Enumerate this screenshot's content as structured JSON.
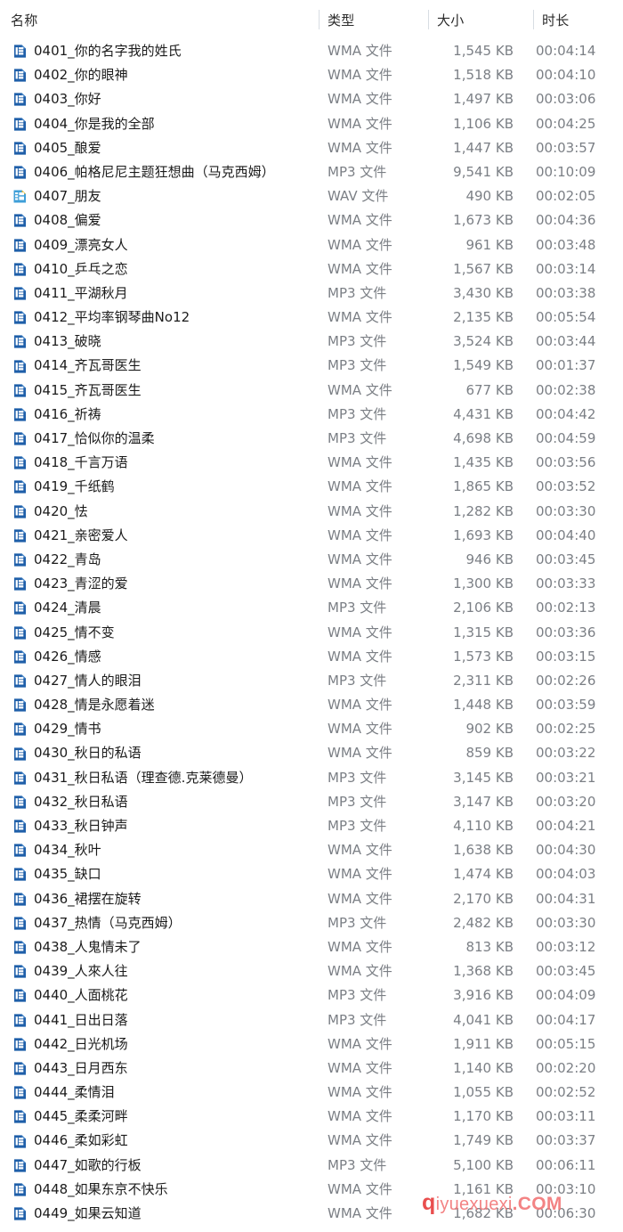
{
  "window": {
    "view": "details",
    "title": "名称"
  },
  "columns": {
    "name": "名称",
    "type": "类型",
    "size": "大小",
    "length": "时长"
  },
  "colors": {
    "header_text": "#2b2b2b",
    "row_text": "#1b1b1b",
    "meta_text": "#7b7f85",
    "separator": "#d8dde3",
    "wma_icon": "#1f5fa9",
    "wav_icon": "#3f9fd8",
    "wav_icon_accent": "#f2c233",
    "watermark": "#f2797a",
    "background": "#ffffff"
  },
  "watermark": {
    "lead": "q",
    "mid": "iyuexuexi",
    "tail": ".COM"
  },
  "icons": {
    "wma": "wma-file-icon",
    "mp3": "mp3-file-icon",
    "wav": "wav-file-icon"
  },
  "rows": [
    {
      "name": "0401_你的名字我的姓氏",
      "type": "WMA 文件",
      "size": "1,545 KB",
      "length": "00:04:14",
      "icon": "wma"
    },
    {
      "name": "0402_你的眼神",
      "type": "WMA 文件",
      "size": "1,518 KB",
      "length": "00:04:10",
      "icon": "wma"
    },
    {
      "name": "0403_你好",
      "type": "WMA 文件",
      "size": "1,497 KB",
      "length": "00:03:06",
      "icon": "wma"
    },
    {
      "name": "0404_你是我的全部",
      "type": "WMA 文件",
      "size": "1,106 KB",
      "length": "00:04:25",
      "icon": "wma"
    },
    {
      "name": "0405_酿爱",
      "type": "WMA 文件",
      "size": "1,447 KB",
      "length": "00:03:57",
      "icon": "wma"
    },
    {
      "name": "0406_帕格尼尼主题狂想曲（马克西姆）",
      "type": "MP3 文件",
      "size": "9,541 KB",
      "length": "00:10:09",
      "icon": "mp3"
    },
    {
      "name": "0407_朋友",
      "type": "WAV 文件",
      "size": "490 KB",
      "length": "00:02:05",
      "icon": "wav"
    },
    {
      "name": "0408_偏爱",
      "type": "WMA 文件",
      "size": "1,673 KB",
      "length": "00:04:36",
      "icon": "wma"
    },
    {
      "name": "0409_漂亮女人",
      "type": "WMA 文件",
      "size": "961 KB",
      "length": "00:03:48",
      "icon": "wma"
    },
    {
      "name": "0410_乒乓之恋",
      "type": "WMA 文件",
      "size": "1,567 KB",
      "length": "00:03:14",
      "icon": "wma"
    },
    {
      "name": "0411_平湖秋月",
      "type": "MP3 文件",
      "size": "3,430 KB",
      "length": "00:03:38",
      "icon": "mp3"
    },
    {
      "name": "0412_平均率钢琴曲No12",
      "type": "WMA 文件",
      "size": "2,135 KB",
      "length": "00:05:54",
      "icon": "wma"
    },
    {
      "name": "0413_破晓",
      "type": "MP3 文件",
      "size": "3,524 KB",
      "length": "00:03:44",
      "icon": "mp3"
    },
    {
      "name": "0414_齐瓦哥医生",
      "type": "MP3 文件",
      "size": "1,549 KB",
      "length": "00:01:37",
      "icon": "mp3"
    },
    {
      "name": "0415_齐瓦哥医生",
      "type": "WMA 文件",
      "size": "677 KB",
      "length": "00:02:38",
      "icon": "wma"
    },
    {
      "name": "0416_祈祷",
      "type": "MP3 文件",
      "size": "4,431 KB",
      "length": "00:04:42",
      "icon": "mp3"
    },
    {
      "name": "0417_恰似你的温柔",
      "type": "MP3 文件",
      "size": "4,698 KB",
      "length": "00:04:59",
      "icon": "mp3"
    },
    {
      "name": "0418_千言万语",
      "type": "WMA 文件",
      "size": "1,435 KB",
      "length": "00:03:56",
      "icon": "wma"
    },
    {
      "name": "0419_千纸鹤",
      "type": "WMA 文件",
      "size": "1,865 KB",
      "length": "00:03:52",
      "icon": "wma"
    },
    {
      "name": "0420_怯",
      "type": "WMA 文件",
      "size": "1,282 KB",
      "length": "00:03:30",
      "icon": "wma"
    },
    {
      "name": "0421_亲密爱人",
      "type": "WMA 文件",
      "size": "1,693 KB",
      "length": "00:04:40",
      "icon": "wma"
    },
    {
      "name": "0422_青岛",
      "type": "WMA 文件",
      "size": "946 KB",
      "length": "00:03:45",
      "icon": "wma"
    },
    {
      "name": "0423_青涩的爱",
      "type": "WMA 文件",
      "size": "1,300 KB",
      "length": "00:03:33",
      "icon": "wma"
    },
    {
      "name": "0424_清晨",
      "type": "MP3 文件",
      "size": "2,106 KB",
      "length": "00:02:13",
      "icon": "mp3"
    },
    {
      "name": "0425_情不变",
      "type": "WMA 文件",
      "size": "1,315 KB",
      "length": "00:03:36",
      "icon": "wma"
    },
    {
      "name": "0426_情感",
      "type": "WMA 文件",
      "size": "1,573 KB",
      "length": "00:03:15",
      "icon": "wma"
    },
    {
      "name": "0427_情人的眼泪",
      "type": "MP3 文件",
      "size": "2,311 KB",
      "length": "00:02:26",
      "icon": "mp3"
    },
    {
      "name": "0428_情是永愿着迷",
      "type": "WMA 文件",
      "size": "1,448 KB",
      "length": "00:03:59",
      "icon": "wma"
    },
    {
      "name": "0429_情书",
      "type": "WMA 文件",
      "size": "902 KB",
      "length": "00:02:25",
      "icon": "wma"
    },
    {
      "name": "0430_秋日的私语",
      "type": "WMA 文件",
      "size": "859 KB",
      "length": "00:03:22",
      "icon": "wma"
    },
    {
      "name": "0431_秋日私语（理查德.克莱德曼）",
      "type": "MP3 文件",
      "size": "3,145 KB",
      "length": "00:03:21",
      "icon": "mp3"
    },
    {
      "name": "0432_秋日私语",
      "type": "MP3 文件",
      "size": "3,147 KB",
      "length": "00:03:20",
      "icon": "mp3"
    },
    {
      "name": "0433_秋日钟声",
      "type": "MP3 文件",
      "size": "4,110 KB",
      "length": "00:04:21",
      "icon": "mp3"
    },
    {
      "name": "0434_秋叶",
      "type": "WMA 文件",
      "size": "1,638 KB",
      "length": "00:04:30",
      "icon": "wma"
    },
    {
      "name": "0435_缺口",
      "type": "WMA 文件",
      "size": "1,474 KB",
      "length": "00:04:03",
      "icon": "wma"
    },
    {
      "name": "0436_裙摆在旋转",
      "type": "WMA 文件",
      "size": "2,170 KB",
      "length": "00:04:31",
      "icon": "wma"
    },
    {
      "name": "0437_热情（马克西姆）",
      "type": "MP3 文件",
      "size": "2,482 KB",
      "length": "00:03:30",
      "icon": "mp3"
    },
    {
      "name": "0438_人鬼情未了",
      "type": "WMA 文件",
      "size": "813 KB",
      "length": "00:03:12",
      "icon": "wma"
    },
    {
      "name": "0439_人來人往",
      "type": "WMA 文件",
      "size": "1,368 KB",
      "length": "00:03:45",
      "icon": "wma"
    },
    {
      "name": "0440_人面桃花",
      "type": "MP3 文件",
      "size": "3,916 KB",
      "length": "00:04:09",
      "icon": "mp3"
    },
    {
      "name": "0441_日出日落",
      "type": "MP3 文件",
      "size": "4,041 KB",
      "length": "00:04:17",
      "icon": "mp3"
    },
    {
      "name": "0442_日光机场",
      "type": "WMA 文件",
      "size": "1,911 KB",
      "length": "00:05:15",
      "icon": "wma"
    },
    {
      "name": "0443_日月西东",
      "type": "WMA 文件",
      "size": "1,140 KB",
      "length": "00:02:20",
      "icon": "wma"
    },
    {
      "name": "0444_柔情泪",
      "type": "WMA 文件",
      "size": "1,055 KB",
      "length": "00:02:52",
      "icon": "wma"
    },
    {
      "name": "0445_柔柔河畔",
      "type": "WMA 文件",
      "size": "1,170 KB",
      "length": "00:03:11",
      "icon": "wma"
    },
    {
      "name": "0446_柔如彩虹",
      "type": "WMA 文件",
      "size": "1,749 KB",
      "length": "00:03:37",
      "icon": "wma"
    },
    {
      "name": "0447_如歌的行板",
      "type": "MP3 文件",
      "size": "5,100 KB",
      "length": "00:06:11",
      "icon": "mp3"
    },
    {
      "name": "0448_如果东京不快乐",
      "type": "WMA 文件",
      "size": "1,161 KB",
      "length": "00:03:10",
      "icon": "wma"
    },
    {
      "name": "0449_如果云知道",
      "type": "WMA 文件",
      "size": "1,682 KB",
      "length": "00:06:30",
      "icon": "wma"
    }
  ]
}
